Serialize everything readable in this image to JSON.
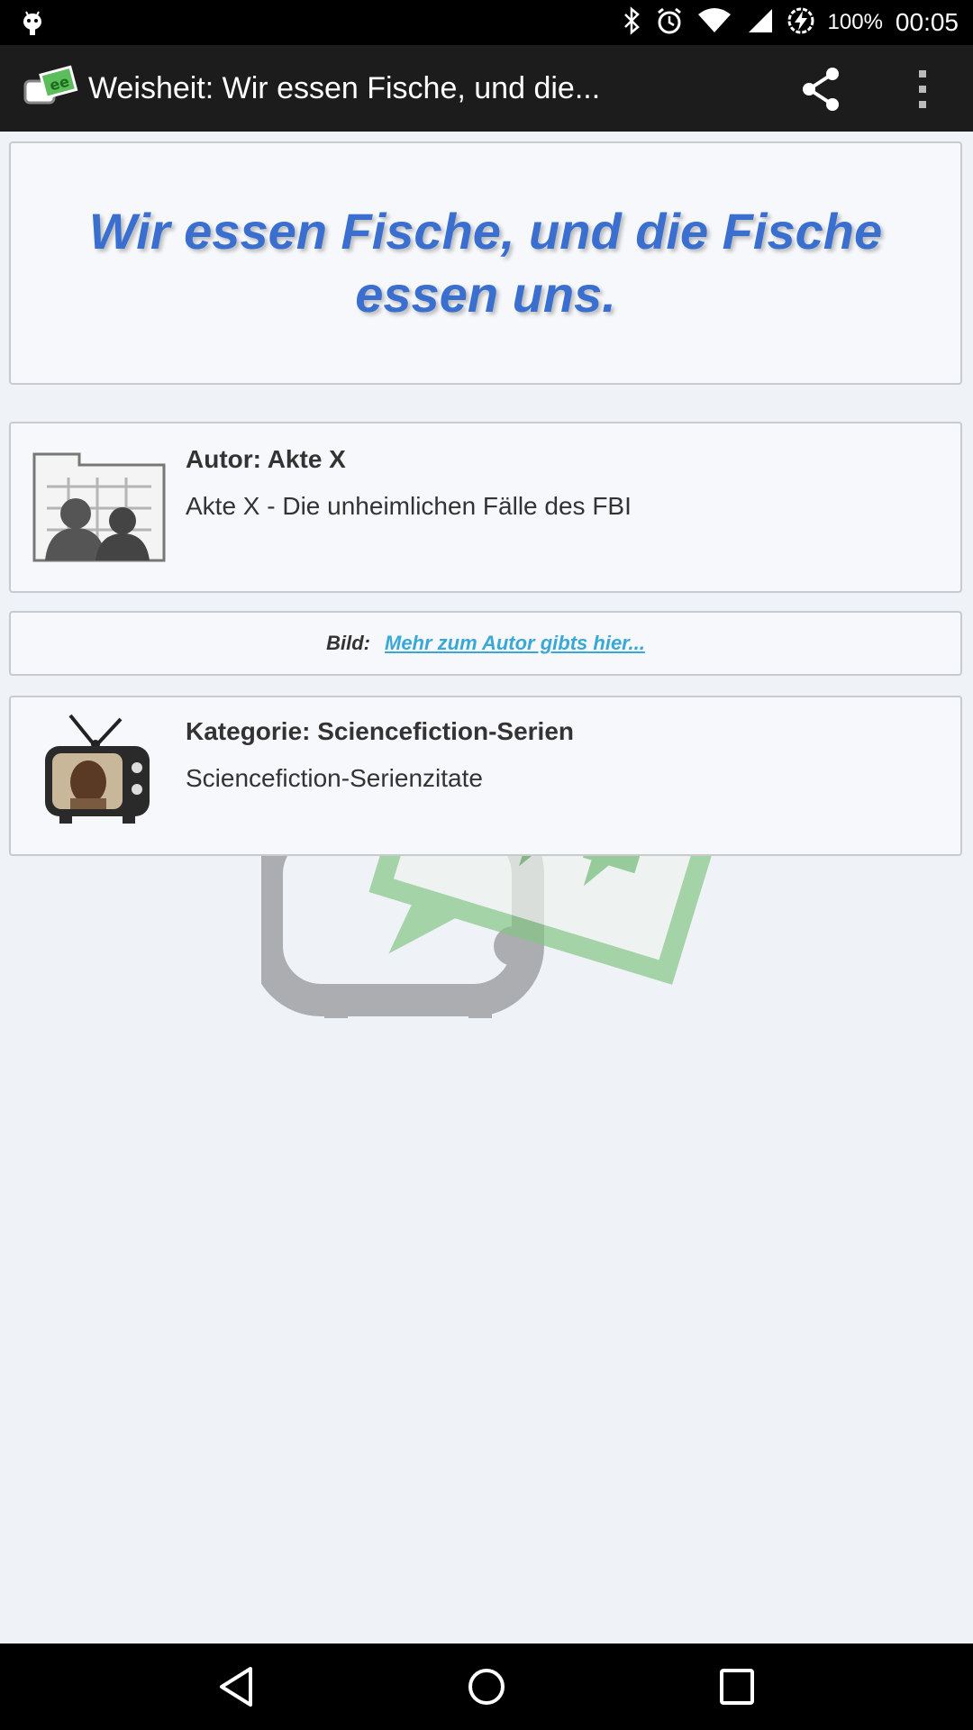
{
  "status_bar": {
    "battery_percent": "100%",
    "time": "00:05",
    "icons": [
      "android-debug-icon",
      "bluetooth-icon",
      "alarm-icon",
      "wifi-icon",
      "signal-icon",
      "battery-charging-icon"
    ]
  },
  "app_bar": {
    "title": "Weisheit: Wir essen Fische, und die...",
    "logo": "app-logo-icon",
    "actions": [
      "share-icon",
      "overflow-menu-icon"
    ]
  },
  "quote": {
    "text": "Wir essen Fische, und die Fische essen uns.",
    "color": "#3a6fd0"
  },
  "author": {
    "heading": "Autor: Akte X",
    "description": "Akte X - Die unheimlichen Fälle des FBI",
    "thumbnail": "author-placeholder-icon"
  },
  "bild": {
    "label": "Bild:",
    "link_text": "Mehr zum Autor gibts hier...",
    "link_color": "#38a8d8"
  },
  "category": {
    "heading": "Kategorie: Sciencefiction-Serien",
    "description": "Sciencefiction-Serienzitate",
    "thumbnail": "tv-icon"
  },
  "nav_bar": {
    "buttons": [
      "back-icon",
      "home-icon",
      "recents-icon"
    ]
  }
}
